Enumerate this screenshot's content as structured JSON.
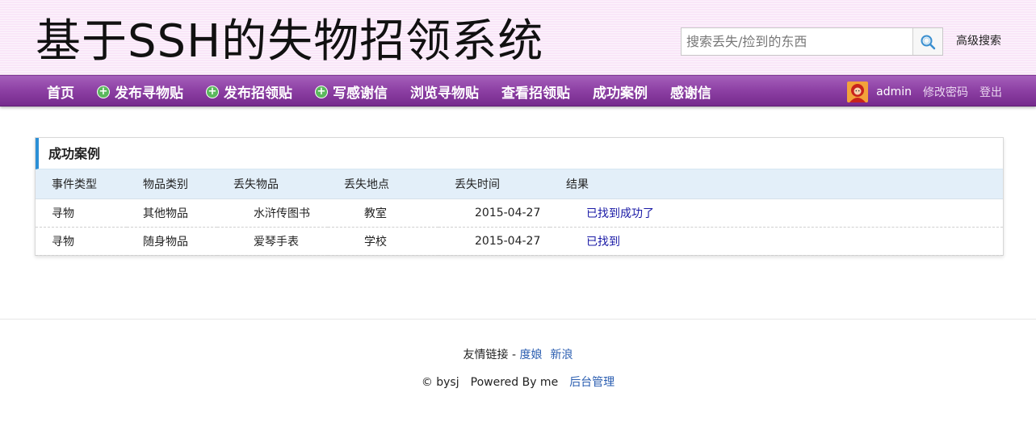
{
  "header": {
    "site_title": "基于SSH的失物招领系统",
    "search_placeholder": "搜索丢失/捡到的东西",
    "search_icon": "search-icon",
    "advanced_search": "高级搜索"
  },
  "nav": {
    "items": [
      {
        "label": "首页",
        "icon": ""
      },
      {
        "label": "发布寻物贴",
        "icon": "plus-circle-icon"
      },
      {
        "label": "发布招领贴",
        "icon": "plus-circle-icon"
      },
      {
        "label": "写感谢信",
        "icon": "plus-circle-icon"
      },
      {
        "label": "浏览寻物贴",
        "icon": ""
      },
      {
        "label": "查看招领贴",
        "icon": ""
      },
      {
        "label": "成功案例",
        "icon": ""
      },
      {
        "label": "感谢信",
        "icon": ""
      }
    ],
    "user": "admin",
    "change_password": "修改密码",
    "logout": "登出"
  },
  "panel": {
    "title": "成功案例",
    "columns": [
      "事件类型",
      "物品类别",
      "丢失物品",
      "丢失地点",
      "丢失时间",
      "结果"
    ],
    "rows": [
      {
        "type": "寻物",
        "category": "其他物品",
        "item": "水浒传图书",
        "place": "教室",
        "time": "2015-04-27",
        "result": "已找到成功了"
      },
      {
        "type": "寻物",
        "category": "随身物品",
        "item": "爱琴手表",
        "place": "学校",
        "time": "2015-04-27",
        "result": "已找到"
      }
    ]
  },
  "footer": {
    "links_label": "友情链接 -",
    "link_1": "度娘",
    "link_2": "新浪",
    "copyright": "© bysj",
    "powered": "Powered By me",
    "admin_link": "后台管理"
  },
  "colors": {
    "header_bg": "#f9e6f8",
    "nav_bg": "#8c3fa3",
    "accent_blue": "#2b8fd6",
    "table_header_bg": "#e3eff9",
    "result_link": "#1a1aa6",
    "plus_icon": "#5bb85d"
  }
}
